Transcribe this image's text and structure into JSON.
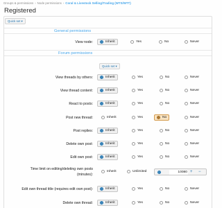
{
  "breadcrumb": [
    "Groups & permissions",
    "Node permissions",
    "Coral & Livestock Selling/Trading (WTS/WTT)"
  ],
  "page_title": "Registered",
  "quick_set_label": "Quick set ▾",
  "sections": {
    "general": "General permissions",
    "forum": "Forum permissions"
  },
  "options": {
    "inherit": "Inherit",
    "yes": "Yes",
    "no": "No",
    "never": "Never",
    "unlimited": "Unlimited"
  },
  "rows": [
    {
      "label": "View node:",
      "selected": "inherit"
    },
    {
      "label": "View threads by others:",
      "selected": "inherit"
    },
    {
      "label": "View thread content:",
      "selected": "inherit"
    },
    {
      "label": "React to posts:",
      "selected": "inherit"
    },
    {
      "label": "Post new thread:",
      "selected": "no"
    },
    {
      "label": "Post replies:",
      "selected": "inherit"
    },
    {
      "label": "Delete own post:",
      "selected": "inherit"
    },
    {
      "label": "Edit own post:",
      "selected": "inherit"
    },
    {
      "label": "Edit own thread title (requires edit own post):",
      "selected": "inherit"
    },
    {
      "label": "Delete own thread:",
      "selected": "inherit"
    }
  ],
  "time_limit": {
    "label_line1": "Time limit on editing/deleting own posts",
    "label_line2": "(minutes):",
    "value": "10080",
    "plus": "+",
    "minus": "−"
  },
  "colors": {
    "link": "#47a7eb",
    "selected_orange": "#f8e3c2",
    "radio_blue": "#2577b1"
  }
}
